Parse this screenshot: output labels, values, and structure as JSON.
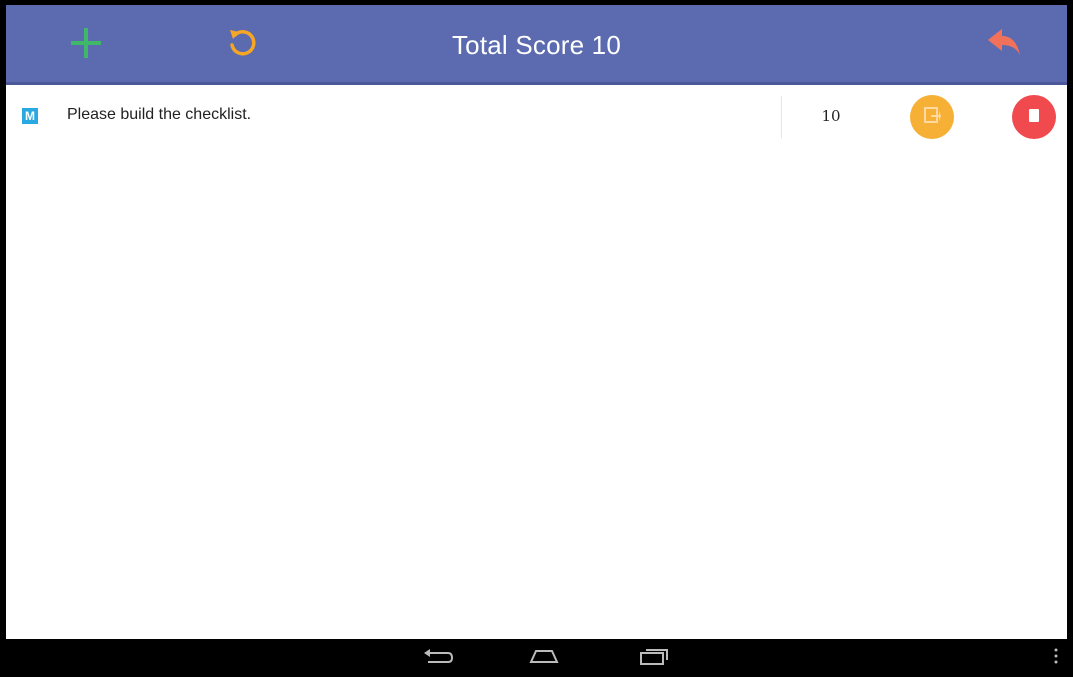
{
  "header": {
    "title": "Total Score 10",
    "add_icon": "plus-icon",
    "refresh_icon": "refresh-icon",
    "back_icon": "reply-arrow-icon",
    "background_color": "#5c6bb0",
    "add_color": "#3fb86a",
    "refresh_color": "#f6a623",
    "back_color": "#f2715a"
  },
  "checklist": {
    "items": [
      {
        "badge": "M",
        "text": "Please build the checklist.",
        "score": "10",
        "edit_icon": "edit-icon",
        "delete_icon": "trash-icon"
      }
    ],
    "badge_color": "#29a9e0",
    "edit_color": "#f6b035",
    "delete_color": "#f04a4e"
  },
  "system_nav": {
    "back_icon": "nav-back-icon",
    "home_icon": "nav-home-icon",
    "recents_icon": "nav-recents-icon",
    "menu_icon": "overflow-menu-icon"
  }
}
